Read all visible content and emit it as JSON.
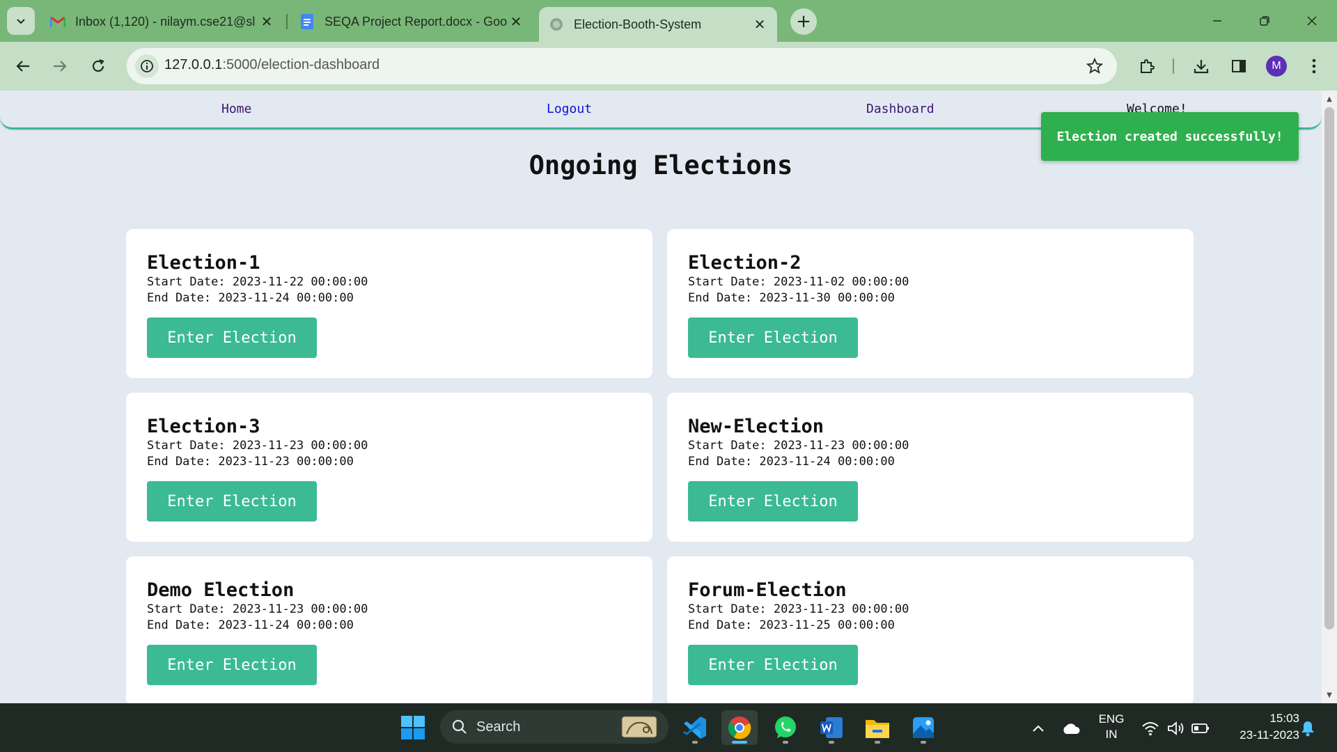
{
  "browser": {
    "tabs": [
      {
        "title": "Inbox (1,120) - nilaym.cse21@sl",
        "favicon": "gmail-icon"
      },
      {
        "title": "SEQA Project Report.docx - Goo",
        "favicon": "google-docs-icon"
      },
      {
        "title": "Election-Booth-System",
        "favicon": "globe-icon",
        "active": true
      }
    ],
    "url_host": "127.0.0.1",
    "url_path": ":5000/election-dashboard",
    "profile_initial": "M"
  },
  "site": {
    "nav": {
      "home": "Home",
      "logout": "Logout",
      "dashboard": "Dashboard",
      "welcome": "Welcome!"
    },
    "toast": "Election created successfully!",
    "page_title": "Ongoing Elections",
    "start_label": "Start Date:",
    "end_label": "End Date:",
    "button_label": "Enter Election",
    "elections": [
      {
        "name": "Election-1",
        "start": "2023-11-22 00:00:00",
        "end": "2023-11-24 00:00:00"
      },
      {
        "name": "Election-2",
        "start": "2023-11-02 00:00:00",
        "end": "2023-11-30 00:00:00"
      },
      {
        "name": "Election-3",
        "start": "2023-11-23 00:00:00",
        "end": "2023-11-23 00:00:00"
      },
      {
        "name": "New-Election",
        "start": "2023-11-23 00:00:00",
        "end": "2023-11-24 00:00:00"
      },
      {
        "name": "Demo Election",
        "start": "2023-11-23 00:00:00",
        "end": "2023-11-24 00:00:00"
      },
      {
        "name": "Forum-Election",
        "start": "2023-11-23 00:00:00",
        "end": "2023-11-25 00:00:00"
      }
    ]
  },
  "taskbar": {
    "search_label": "Search",
    "language_line1": "ENG",
    "language_line2": "IN",
    "time": "15:03",
    "date": "23-11-2023"
  },
  "colors": {
    "accent_button": "#3bba93",
    "toast_bg": "#2fb04e",
    "browser_frame": "#79b778",
    "page_bg": "#e2e9f1"
  }
}
